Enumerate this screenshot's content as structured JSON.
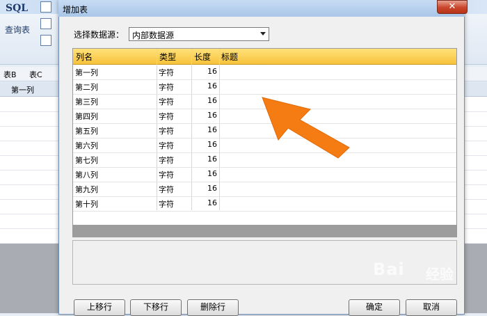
{
  "background_app": {
    "logo": "SQL",
    "query_label": "查询表",
    "tabs": [
      "表B",
      "表C"
    ],
    "column_header": "第一列"
  },
  "dialog": {
    "title": "增加表",
    "close_symbol": "✕",
    "datasource": {
      "label": "选择数据源：",
      "value": "内部数据源"
    },
    "grid": {
      "headers": [
        "列名",
        "类型",
        "长度",
        "标题"
      ],
      "rows": [
        {
          "name": "第一列",
          "type": "字符",
          "length": "16",
          "caption": ""
        },
        {
          "name": "第二列",
          "type": "字符",
          "length": "16",
          "caption": ""
        },
        {
          "name": "第三列",
          "type": "字符",
          "length": "16",
          "caption": ""
        },
        {
          "name": "第四列",
          "type": "字符",
          "length": "16",
          "caption": ""
        },
        {
          "name": "第五列",
          "type": "字符",
          "length": "16",
          "caption": ""
        },
        {
          "name": "第六列",
          "type": "字符",
          "length": "16",
          "caption": ""
        },
        {
          "name": "第七列",
          "type": "字符",
          "length": "16",
          "caption": ""
        },
        {
          "name": "第八列",
          "type": "字符",
          "length": "16",
          "caption": ""
        },
        {
          "name": "第九列",
          "type": "字符",
          "length": "16",
          "caption": ""
        },
        {
          "name": "第十列",
          "type": "字符",
          "length": "16",
          "caption": ""
        }
      ]
    },
    "buttons": {
      "move_up": "上移行",
      "move_down": "下移行",
      "delete_row": "删除行",
      "ok": "确定",
      "cancel": "取消"
    }
  },
  "watermark": {
    "brand": "Bai",
    "brand2": "经验"
  },
  "colors": {
    "header_yellow": "#f7c23c",
    "arrow_orange": "#f57c12",
    "close_red": "#c9452b"
  }
}
